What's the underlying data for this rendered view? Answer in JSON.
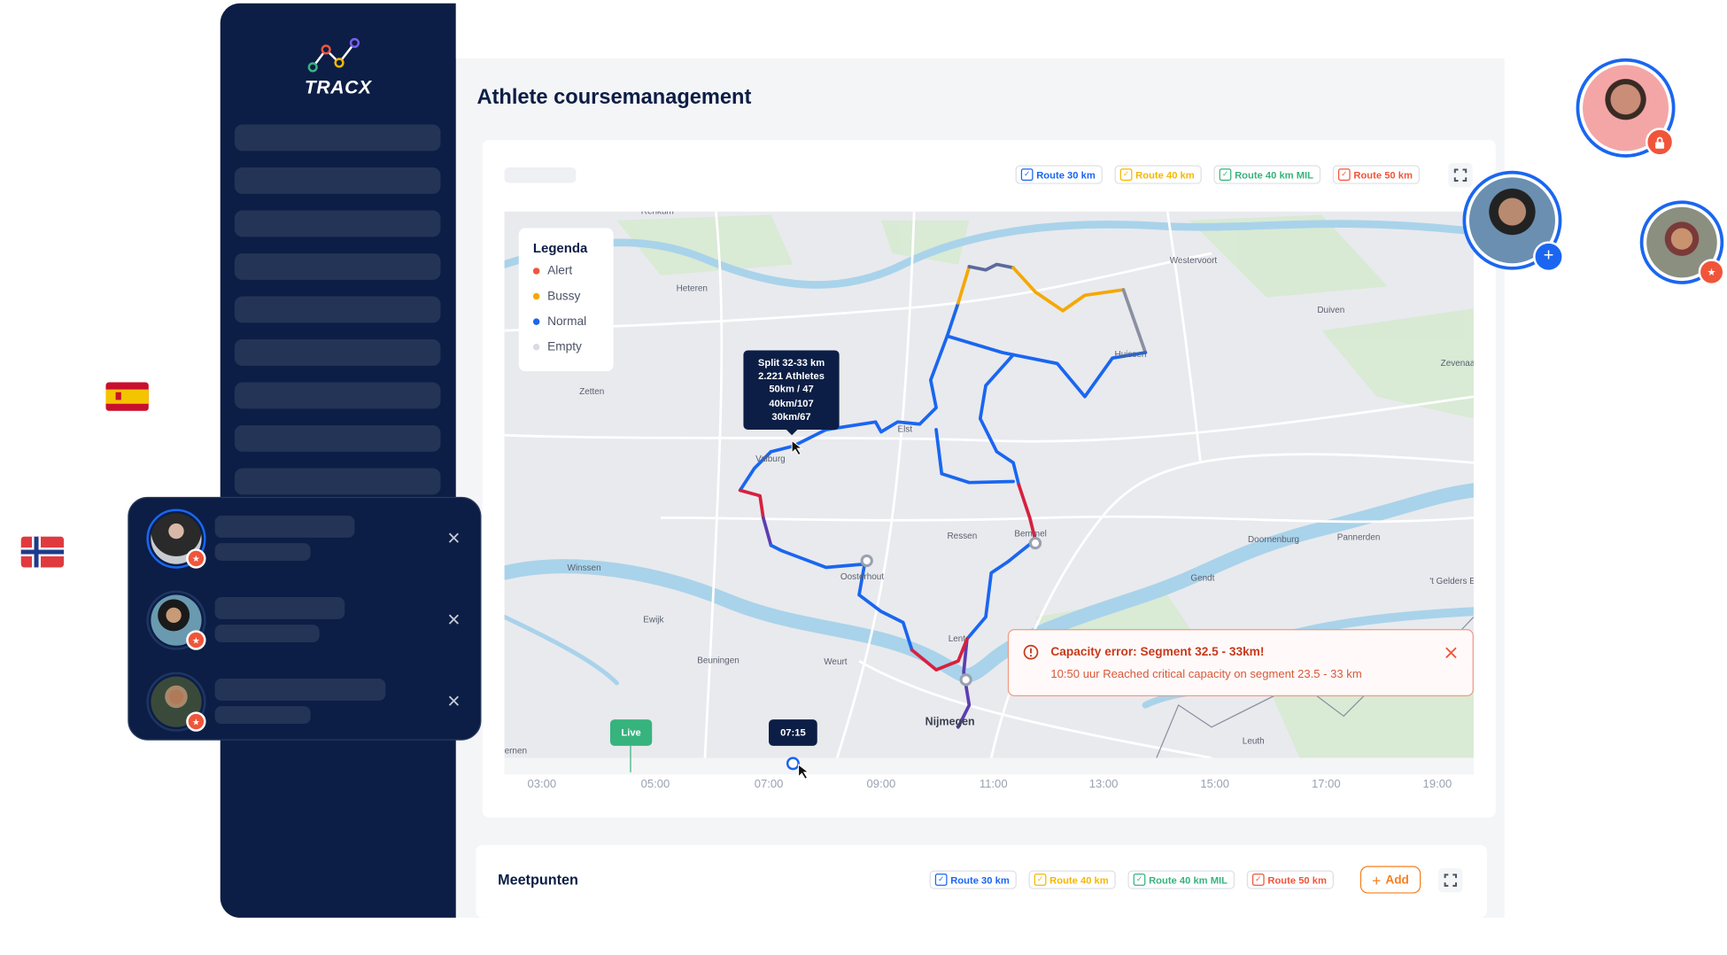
{
  "app": {
    "logo": "TRACX"
  },
  "page": {
    "title": "Athlete coursemanagement"
  },
  "route_filters": [
    {
      "label": "Route 30 km",
      "color": "#1a66f0"
    },
    {
      "label": "Route 40 km",
      "color": "#f5b800"
    },
    {
      "label": "Route 40 km MIL",
      "color": "#37b37e"
    },
    {
      "label": "Route 50 km",
      "color": "#f0553a"
    }
  ],
  "legend": {
    "title": "Legenda",
    "items": [
      {
        "label": "Alert",
        "color": "#f0553a"
      },
      {
        "label": "Bussy",
        "color": "#f5a800"
      },
      {
        "label": "Normal",
        "color": "#1a66f0"
      },
      {
        "label": "Empty",
        "color": "#d9dce2"
      }
    ]
  },
  "tooltip": {
    "lines": [
      "Split 32-33 km",
      "2.221 Athletes",
      "50km / 47",
      "40km/107",
      "30km/67"
    ]
  },
  "error": {
    "title": "Capacity error: Segment 32.5 - 33km!",
    "message": "10:50 uur Reached critical capacity on segment 23.5 - 33 km"
  },
  "map": {
    "places": [
      "Renkum",
      "Heteren",
      "Zetten",
      "Elst",
      "Valburg",
      "Westervoort",
      "Duiven",
      "Huissen",
      "Zevenaar",
      "Bemmel",
      "Ressen",
      "Oosterhout",
      "Doornenburg",
      "Pannerden",
      "Gendt",
      "'t Gelders Eil",
      "Winssen",
      "Ewijk",
      "Beuningen",
      "Weurt",
      "Lent",
      "Nijmegen",
      "Leuth",
      "ernen"
    ]
  },
  "timeline": {
    "ticks": [
      "03:00",
      "05:00",
      "07:00",
      "09:00",
      "11:00",
      "13:00",
      "15:00",
      "17:00",
      "19:00"
    ],
    "live_label": "Live",
    "current_time": "07:15"
  },
  "meetpunten": {
    "title": "Meetpunten",
    "add_label": "Add"
  },
  "colors": {
    "navy": "#0c1e45",
    "accent": "#1a66f0",
    "alert": "#f0553a",
    "add": "#f5801f"
  }
}
